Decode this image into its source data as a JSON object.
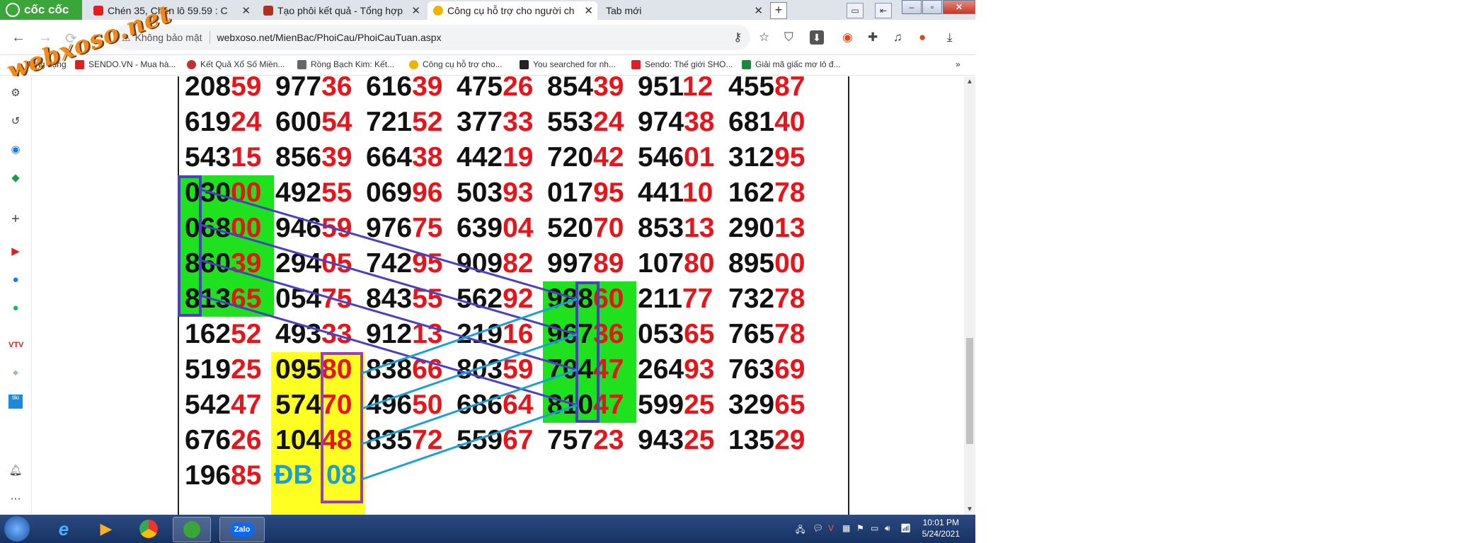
{
  "browser": {
    "brand": "cốc cốc",
    "tabs": [
      {
        "title": "Chén 35, Chén lô 59.59 : C",
        "icon_color": "#e02020"
      },
      {
        "title": "Tạo phôi kết quả - Tổng hợp",
        "icon_color": "#b03020"
      },
      {
        "title": "Công cụ hỗ trợ cho người ch",
        "icon_color": "#f0b400",
        "active": true
      },
      {
        "title": "Tab mới",
        "icon_color": "#ffffff"
      }
    ],
    "security_label": "Không bảo mật",
    "url": "webxoso.net/MienBac/PhoiCau/PhoiCauTuan.aspx"
  },
  "bookmarks": [
    {
      "label": "Ứng dụng",
      "color": "#3a7bd5"
    },
    {
      "label": "SENDO.VN - Mua hà...",
      "color": "#e02020"
    },
    {
      "label": "Kết Quả Xổ Số Miền...",
      "color": "#c03030"
    },
    {
      "label": "Rồng Bạch Kim: Kết...",
      "color": "#666666"
    },
    {
      "label": "Công cụ hỗ trợ cho...",
      "color": "#f0b400"
    },
    {
      "label": "You searched for nh...",
      "color": "#222222"
    },
    {
      "label": "Sendo: Thế giới SHO...",
      "color": "#e02020"
    },
    {
      "label": "Giải mã giấc mơ lô đ...",
      "color": "#1a8a3a"
    }
  ],
  "watermark": "webxoso.net",
  "sidebar_icons": [
    "gear-icon",
    "history-icon",
    "messenger-icon",
    "game-icon",
    "plus-icon",
    "youtube-icon",
    "facebook-icon",
    "spotify-icon",
    "vtv-icon",
    "maps-icon",
    "tiki-icon",
    "bell-icon",
    "more-icon"
  ],
  "grid": {
    "rows": [
      [
        [
          "208",
          "59"
        ],
        [
          "977",
          "36"
        ],
        [
          "616",
          "39"
        ],
        [
          "475",
          "26"
        ],
        [
          "854",
          "39"
        ],
        [
          "951",
          "12"
        ],
        [
          "455",
          "87"
        ]
      ],
      [
        [
          "619",
          "24"
        ],
        [
          "600",
          "54"
        ],
        [
          "721",
          "52"
        ],
        [
          "377",
          "33"
        ],
        [
          "553",
          "24"
        ],
        [
          "974",
          "38"
        ],
        [
          "681",
          "40"
        ]
      ],
      [
        [
          "543",
          "15"
        ],
        [
          "856",
          "39"
        ],
        [
          "664",
          "38"
        ],
        [
          "442",
          "19"
        ],
        [
          "720",
          "42"
        ],
        [
          "546",
          "01"
        ],
        [
          "312",
          "95"
        ]
      ],
      [
        [
          "030",
          "00"
        ],
        [
          "492",
          "55"
        ],
        [
          "069",
          "96"
        ],
        [
          "503",
          "93"
        ],
        [
          "017",
          "95"
        ],
        [
          "441",
          "10"
        ],
        [
          "162",
          "78"
        ]
      ],
      [
        [
          "068",
          "00"
        ],
        [
          "946",
          "59"
        ],
        [
          "976",
          "75"
        ],
        [
          "639",
          "04"
        ],
        [
          "520",
          "70"
        ],
        [
          "853",
          "13"
        ],
        [
          "290",
          "13"
        ]
      ],
      [
        [
          "860",
          "39"
        ],
        [
          "294",
          "05"
        ],
        [
          "742",
          "95"
        ],
        [
          "909",
          "82"
        ],
        [
          "997",
          "89"
        ],
        [
          "107",
          "80"
        ],
        [
          "895",
          "00"
        ]
      ],
      [
        [
          "813",
          "65"
        ],
        [
          "054",
          "75"
        ],
        [
          "843",
          "55"
        ],
        [
          "562",
          "92"
        ],
        [
          "988",
          "60"
        ],
        [
          "211",
          "77"
        ],
        [
          "732",
          "78"
        ]
      ],
      [
        [
          "162",
          "52"
        ],
        [
          "493",
          "33"
        ],
        [
          "912",
          "13"
        ],
        [
          "219",
          "16"
        ],
        [
          "967",
          "36"
        ],
        [
          "053",
          "65"
        ],
        [
          "765",
          "78"
        ]
      ],
      [
        [
          "519",
          "25"
        ],
        [
          "095",
          "80"
        ],
        [
          "838",
          "66"
        ],
        [
          "803",
          "59"
        ],
        [
          "704",
          "47"
        ],
        [
          "264",
          "93"
        ],
        [
          "763",
          "69"
        ]
      ],
      [
        [
          "542",
          "47"
        ],
        [
          "574",
          "70"
        ],
        [
          "496",
          "50"
        ],
        [
          "686",
          "64"
        ],
        [
          "810",
          "47"
        ],
        [
          "599",
          "25"
        ],
        [
          "329",
          "65"
        ]
      ],
      [
        [
          "676",
          "26"
        ],
        [
          "104",
          "48"
        ],
        [
          "835",
          "72"
        ],
        [
          "559",
          "67"
        ],
        [
          "757",
          "23"
        ],
        [
          "943",
          "25"
        ],
        [
          "135",
          "29"
        ]
      ],
      [
        [
          "196",
          "85"
        ]
      ]
    ],
    "db_label": "ĐB",
    "db_value": "08"
  },
  "taskbar": {
    "apps": [
      "ie-icon",
      "media-player-icon",
      "chrome-icon",
      "coccoc-icon",
      "zalo-icon"
    ],
    "zalo_label": "Zalo",
    "time": "10:01 PM",
    "date": "5/24/2021"
  },
  "colors": {
    "green_highlight": "#1de21d",
    "yellow_highlight": "#ffff22",
    "line_purple": "#4b3fc4",
    "line_cyan": "#1aa0d8",
    "red_digit": "#e8141a"
  }
}
